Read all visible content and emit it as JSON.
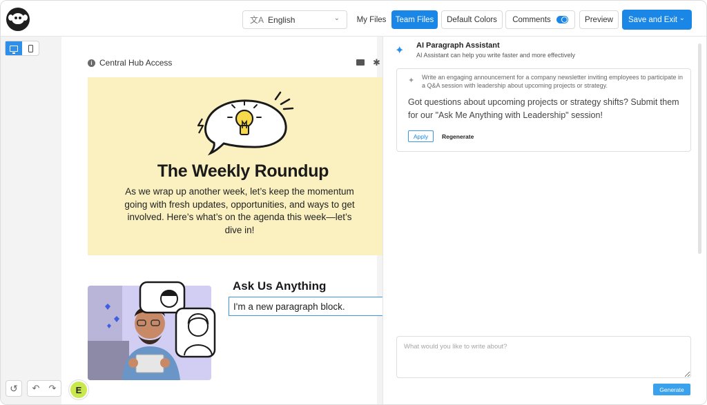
{
  "topbar": {
    "language": {
      "value": "English",
      "icon": "translate-icon"
    },
    "my_files": "My Files",
    "team_files": "Team Files",
    "default_colors": "Default Colors",
    "comments": "Comments",
    "comments_toggle_on": true,
    "preview": "Preview",
    "save_and_exit": "Save and Exit",
    "accent": "#1a86e6"
  },
  "device_toggle": {
    "selected": "desktop"
  },
  "editor": {
    "header_label": "Central Hub Access",
    "hero": {
      "title": "The Weekly Roundup",
      "body": "As we wrap up another week, let’s keep the momentum going with fresh updates, opportunities, and ways to get involved. Here’s what’s on the agenda this week—let’s dive in!",
      "background": "#fbf1c0"
    },
    "section_title": "Ask Us Anything",
    "new_paragraph": "I'm a new paragraph block.",
    "collaborator_initial": "E"
  },
  "ai_panel": {
    "title": "AI Paragraph Assistant",
    "subtitle": "AI Assistant can help you write faster and more effectively",
    "prompt": "Write an engaging announcement for a company newsletter inviting employees to participate in a Q&A session with leadership about upcoming projects or strategy.",
    "result": "Got questions about upcoming projects or strategy shifts? Submit them for our \"Ask Me Anything with Leadership\" session!",
    "apply": "Apply",
    "regenerate": "Regenerate",
    "input_placeholder": "What would you like to write about?",
    "generate": "Generate"
  }
}
